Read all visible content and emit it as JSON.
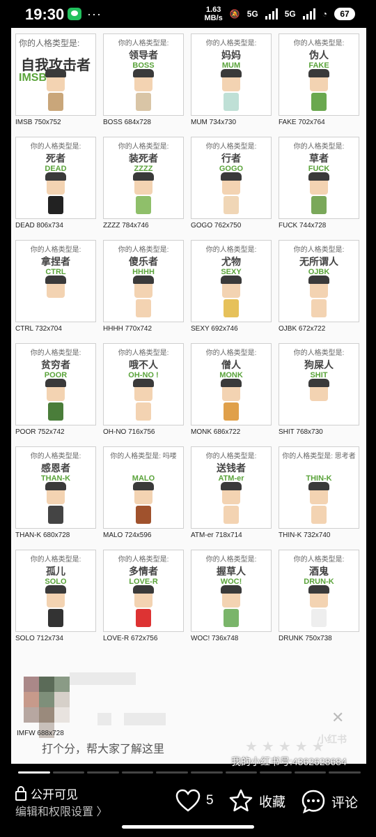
{
  "status_bar": {
    "time": "19:30",
    "dots": "···",
    "speed_value": "1.63",
    "speed_unit": "MB/s",
    "network1": "5G",
    "network2": "5G",
    "battery": "67"
  },
  "grid": {
    "first_card": {
      "subtitle": "你的人格类型是:",
      "cn": "自我攻击者",
      "en": "IMSB",
      "caption": "IMSB 750x752"
    },
    "cards": [
      {
        "subtitle": "你的人格类型是:",
        "cn": "领导者",
        "en": "BOSS",
        "caption": "BOSS 684x728"
      },
      {
        "subtitle": "你的人格类型是:",
        "cn": "妈妈",
        "en": "MUM",
        "caption": "MUM 734x730"
      },
      {
        "subtitle": "你的人格类型是:",
        "cn": "伪人",
        "en": "FAKE",
        "caption": "FAKE 702x764"
      },
      {
        "subtitle": "你的人格类型是:",
        "cn": "死者",
        "en": "DEAD",
        "caption": "DEAD 806x734"
      },
      {
        "subtitle": "你的人格类型是:",
        "cn": "装死者",
        "en": "ZZZZ",
        "caption": "ZZZZ 784x746"
      },
      {
        "subtitle": "你的人格类型是:",
        "cn": "行者",
        "en": "GOGO",
        "caption": "GOGO 762x750"
      },
      {
        "subtitle": "你的人格类型是:",
        "cn": "草者",
        "en": "FUCK",
        "caption": "FUCK 744x728"
      },
      {
        "subtitle": "你的人格类型是:",
        "cn": "拿捏者",
        "en": "CTRL",
        "caption": "CTRL 732x704"
      },
      {
        "subtitle": "你的人格类型是:",
        "cn": "傻乐者",
        "en": "HHHH",
        "caption": "HHHH 770x742"
      },
      {
        "subtitle": "你的人格类型是:",
        "cn": "尤物",
        "en": "SEXY",
        "caption": "SEXY 692x746"
      },
      {
        "subtitle": "你的人格类型是:",
        "cn": "无所谓人",
        "en": "OJBK",
        "caption": "OJBK 672x722"
      },
      {
        "subtitle": "你的人格类型是:",
        "cn": "贫穷者",
        "en": "POOR",
        "caption": "POOR 752x742"
      },
      {
        "subtitle": "你的人格类型是:",
        "cn": "哦不人",
        "en": "OH-NO !",
        "caption": "OH-NO 716x756"
      },
      {
        "subtitle": "你的人格类型是:",
        "cn": "僧人",
        "en": "MONK",
        "caption": "MONK 686x722"
      },
      {
        "subtitle": "你的人格类型是:",
        "cn": "狗屎人",
        "en": "SHIT",
        "caption": "SHIT 768x730"
      },
      {
        "subtitle": "你的人格类型是:",
        "cn": "感恩者",
        "en": "THAN-K",
        "caption": "THAN-K 680x728"
      },
      {
        "subtitle": "你的人格类型是: 吗喽",
        "cn": "",
        "en": "MALO",
        "caption": "MALO 724x596"
      },
      {
        "subtitle": "你的人格类型是:",
        "cn": "送钱者",
        "en": "ATM-er",
        "caption": "ATM-er 718x714"
      },
      {
        "subtitle": "你的人格类型是: 思考者",
        "cn": "",
        "en": "THIN-K",
        "caption": "THIN-K 732x740"
      },
      {
        "subtitle": "你的人格类型是:",
        "cn": "孤儿",
        "en": "SOLO",
        "caption": "SOLO 712x734"
      },
      {
        "subtitle": "你的人格类型是:",
        "cn": "多情者",
        "en": "LOVE-R",
        "caption": "LOVE-R 672x756"
      },
      {
        "subtitle": "你的人格类型是:",
        "cn": "握草人",
        "en": "WOC!",
        "caption": "WOC! 736x748"
      },
      {
        "subtitle": "你的人格类型是:",
        "cn": "酒鬼",
        "en": "DRUN-K",
        "caption": "DRUNK 750x738"
      }
    ],
    "lower_caption": "IMFW 688x728"
  },
  "overlay": {
    "comment_prompt": "打个分，帮大家了解这里",
    "watermark_id": "我的小红书号:4362628684",
    "watermark_logo": "小红书",
    "stars": "★★★★★"
  },
  "bottom_bar": {
    "visibility": "公开可见",
    "permissions": "编辑和权限设置 〉",
    "like_count": "5",
    "collect_label": "收藏",
    "comment_label": "评论"
  },
  "colors": {
    "accent_green": "#5aa33a",
    "background": "#000000"
  }
}
